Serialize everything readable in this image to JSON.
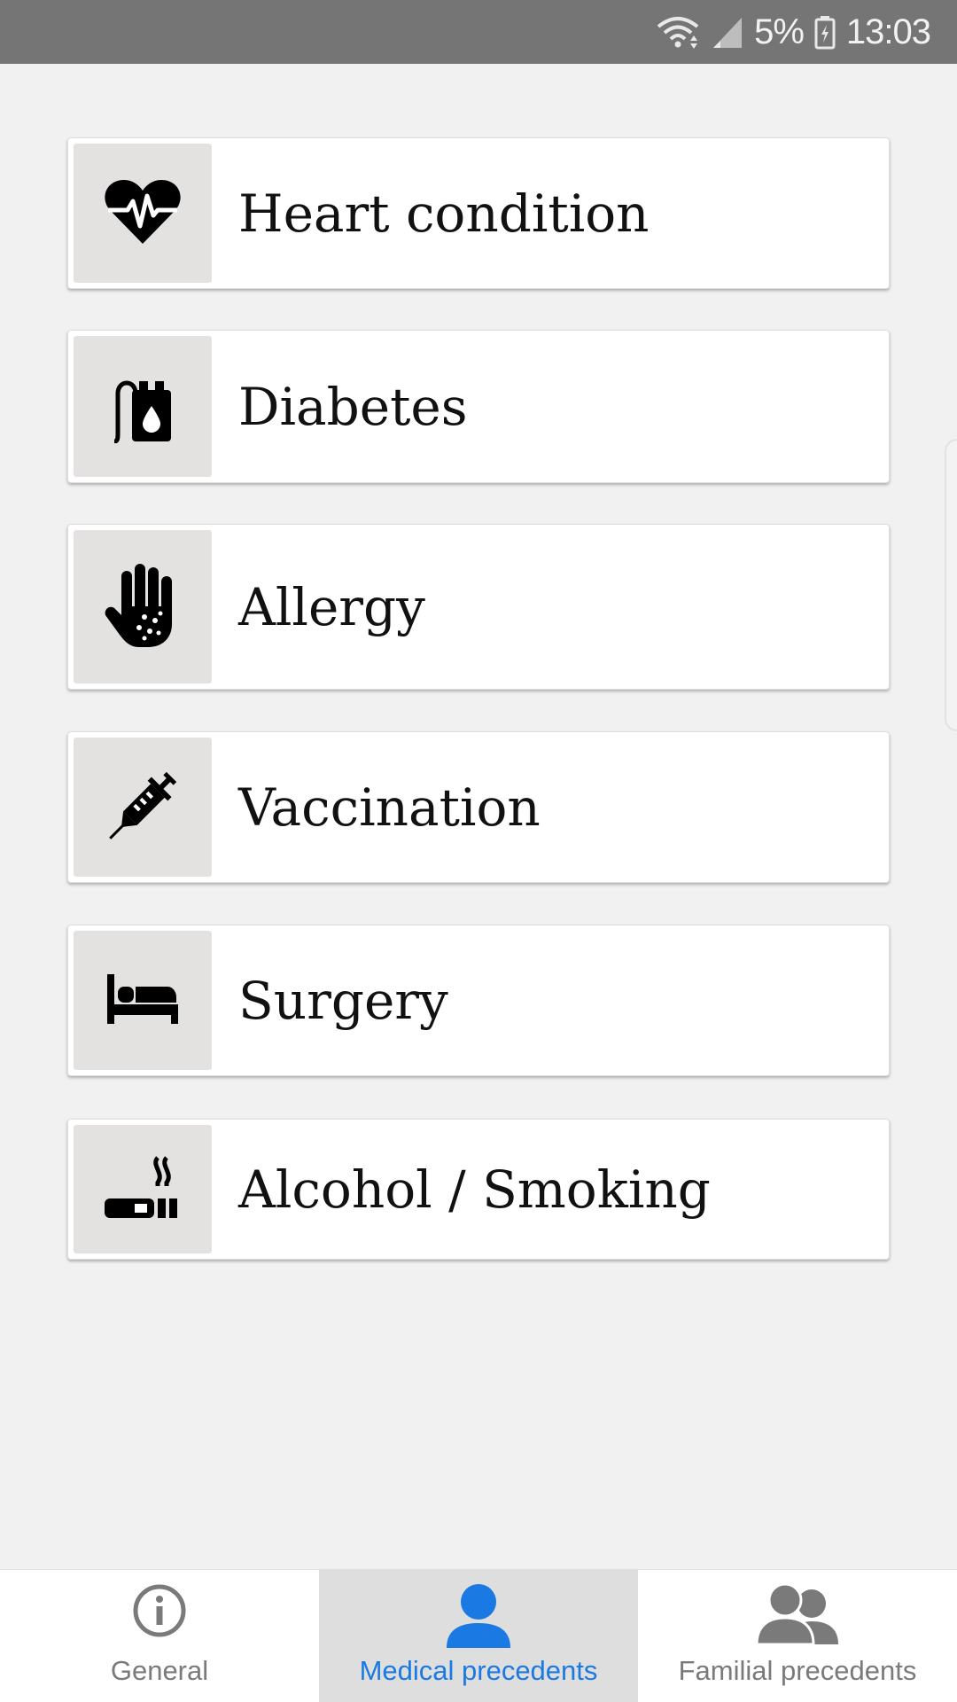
{
  "status_bar": {
    "battery": "5%",
    "time": "13:03",
    "icons": [
      "wifi-icon",
      "signal-icon",
      "battery-icon"
    ],
    "color": "#757575"
  },
  "list": {
    "items": [
      {
        "label": "Heart condition",
        "icon": "heart-pulse-icon"
      },
      {
        "label": "Diabetes",
        "icon": "insulin-pump-icon"
      },
      {
        "label": "Allergy",
        "icon": "allergy-hand-icon"
      },
      {
        "label": "Vaccination",
        "icon": "syringe-icon"
      },
      {
        "label": "Surgery",
        "icon": "bed-icon"
      },
      {
        "label": "Alcohol / Smoking",
        "icon": "cigarette-icon"
      }
    ],
    "icon_bg_color": "#e4e1e1"
  },
  "bottom_nav": {
    "tabs": [
      {
        "label": "General",
        "icon": "info-icon",
        "active": false
      },
      {
        "label": "Medical precedents",
        "icon": "person-icon",
        "active": true
      },
      {
        "label": "Familial precedents",
        "icon": "people-icon",
        "active": false
      }
    ],
    "active_color": "#1a79e3",
    "inactive_color": "#7a7a7a"
  }
}
